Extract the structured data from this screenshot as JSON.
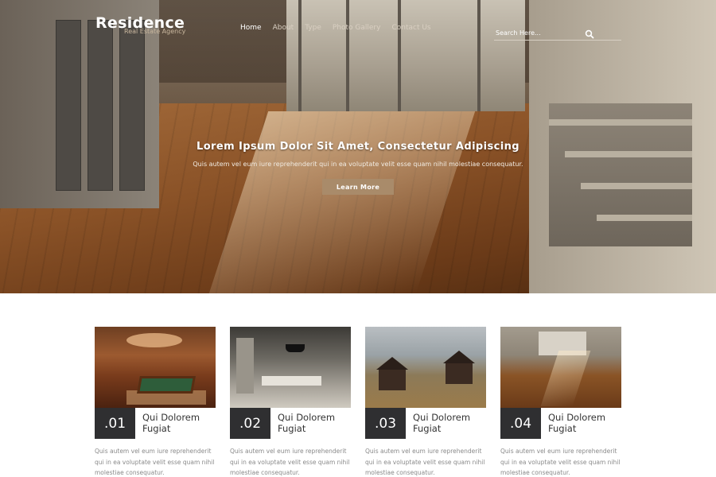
{
  "header": {
    "brand_title": "Residence",
    "brand_subtitle": "Real Estate Agency",
    "nav": [
      {
        "label": "Home",
        "active": true
      },
      {
        "label": "About",
        "active": false
      },
      {
        "label": "Type",
        "active": false
      },
      {
        "label": "Photo Gallery",
        "active": false
      },
      {
        "label": "Contact Us",
        "active": false
      }
    ],
    "search_placeholder": "Search Here...",
    "search_icon": "search-icon"
  },
  "hero": {
    "heading": "Lorem Ipsum Dolor Sit Amet, Consectetur Adipiscing",
    "subtext": "Quis autem vel eum iure reprehenderit qui in ea voluptate velit esse quam nihil molestiae consequatur.",
    "button_label": "Learn More"
  },
  "cards": [
    {
      "number": ".01",
      "title": "Qui Dolorem Fugiat",
      "text": "Quis autem vel eum iure reprehenderit qui in ea voluptate velit esse quam nihil molestiae consequatur."
    },
    {
      "number": ".02",
      "title": "Qui Dolorem Fugiat",
      "text": "Quis autem vel eum iure reprehenderit qui in ea voluptate velit esse quam nihil molestiae consequatur."
    },
    {
      "number": ".03",
      "title": "Qui Dolorem Fugiat",
      "text": "Quis autem vel eum iure reprehenderit qui in ea voluptate velit esse quam nihil molestiae consequatur."
    },
    {
      "number": ".04",
      "title": "Qui Dolorem Fugiat",
      "text": "Quis autem vel eum iure reprehenderit qui in ea voluptate velit esse quam nihil molestiae consequatur."
    }
  ],
  "colors": {
    "accent_button": "#a98b6a",
    "number_badge": "#2f2f31",
    "card_text": "#8a8a8a"
  }
}
